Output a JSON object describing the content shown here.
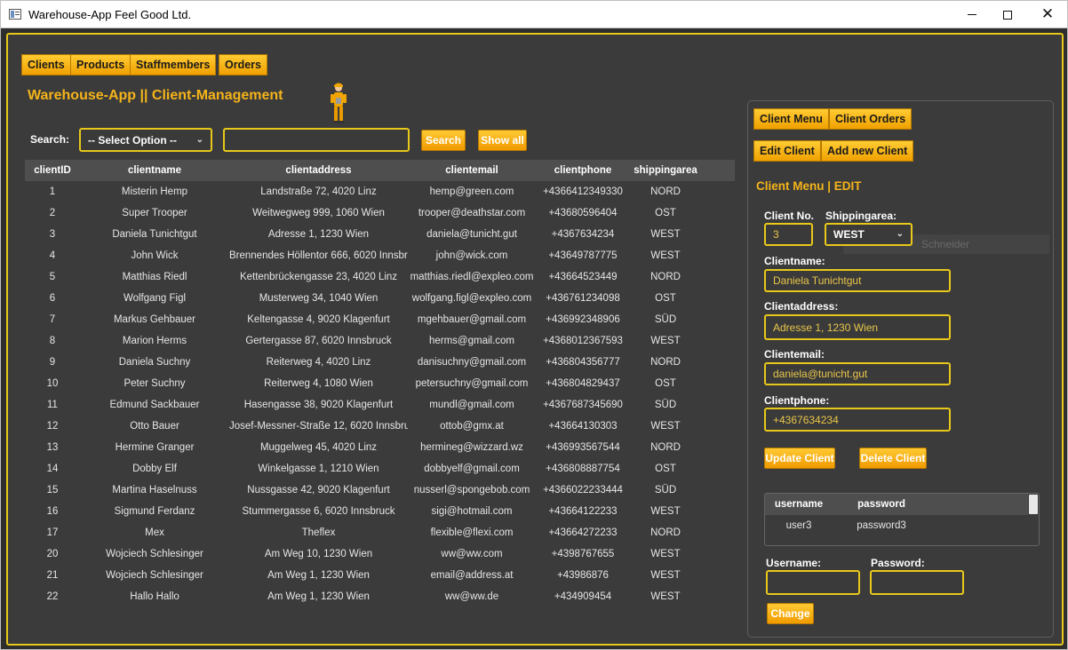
{
  "window": {
    "title": "Warehouse-App Feel Good Ltd."
  },
  "nav_tabs": [
    "Clients",
    "Products",
    "Staffmembers",
    "Orders"
  ],
  "page_title": "Warehouse-App || Client-Management",
  "search": {
    "label": "Search:",
    "select_value": "-- Select Option --",
    "input_value": "",
    "search_button": "Search",
    "show_all_button": "Show all"
  },
  "table": {
    "columns": [
      "clientID",
      "clientname",
      "clientaddress",
      "clientemail",
      "clientphone",
      "shippingarea"
    ],
    "rows": [
      [
        "1",
        "Misterin Hemp",
        "Landstraße 72, 4020 Linz",
        "hemp@green.com",
        "+4366412349330",
        "NORD"
      ],
      [
        "2",
        "Super Trooper",
        "Weitwegweg 999, 1060 Wien",
        "trooper@deathstar.com",
        "+43680596404",
        "OST"
      ],
      [
        "3",
        "Daniela Tunichtgut",
        "Adresse 1, 1230 Wien",
        "daniela@tunicht.gut",
        "+4367634234",
        "WEST"
      ],
      [
        "4",
        "John Wick",
        "Brennendes Höllentor 666, 6020 Innsbruck",
        "john@wick.com",
        "+43649787775",
        "WEST"
      ],
      [
        "5",
        "Matthias Riedl",
        "Kettenbrückengasse 23, 4020 Linz",
        "matthias.riedl@expleo.com",
        "+43664523449",
        "NORD"
      ],
      [
        "6",
        "Wolfgang Figl",
        "Musterweg 34, 1040 Wien",
        "wolfgang.figl@expleo.com",
        "+436761234098",
        "OST"
      ],
      [
        "7",
        "Markus Gehbauer",
        "Keltengasse 4, 9020 Klagenfurt",
        "mgehbauer@gmail.com",
        "+436992348906",
        "SÜD"
      ],
      [
        "8",
        "Marion Herms",
        "Gertergasse 87, 6020 Innsbruck",
        "herms@gmail.com",
        "+4368012367593",
        "WEST"
      ],
      [
        "9",
        "Daniela Suchny",
        "Reiterweg 4, 4020 Linz",
        "danisuchny@gmail.com",
        "+436804356777",
        "NORD"
      ],
      [
        "10",
        "Peter Suchny",
        "Reiterweg 4, 1080 Wien",
        "petersuchny@gmail.com",
        "+436804829437",
        "OST"
      ],
      [
        "11",
        "Edmund Sackbauer",
        "Hasengasse 38, 9020 Klagenfurt",
        "mundl@gmail.com",
        "+4367687345690",
        "SÜD"
      ],
      [
        "12",
        "Otto Bauer",
        "Josef-Messner-Straße 12, 6020 Innsbruck",
        "ottob@gmx.at",
        "+43664130303",
        "WEST"
      ],
      [
        "13",
        "Hermine Granger",
        "Muggelweg 45, 4020 Linz",
        "hermineg@wizzard.wz",
        "+436993567544",
        "NORD"
      ],
      [
        "14",
        "Dobby Elf",
        "Winkelgasse 1, 1210 Wien",
        "dobbyelf@gmail.com",
        "+436808887754",
        "OST"
      ],
      [
        "15",
        "Martina Haselnuss",
        "Nussgasse 42, 9020 Klagenfurt",
        "nusserl@spongebob.com",
        "+4366022233444",
        "SÜD"
      ],
      [
        "16",
        "Sigmund Ferdanz",
        "Stummergasse 6, 6020 Innsbruck",
        "sigi@hotmail.com",
        "+43664122233",
        "WEST"
      ],
      [
        "17",
        "Mex",
        "Theflex",
        "flexible@flexi.com",
        "+43664272233",
        "NORD"
      ],
      [
        "20",
        "Wojciech Schlesinger",
        "Am Weg 10, 1230 Wien",
        "ww@ww.com",
        "+4398767655",
        "WEST"
      ],
      [
        "21",
        "Wojciech Schlesinger",
        "Am Weg 1, 1230 Wien",
        "email@address.at",
        "+43986876",
        "WEST"
      ],
      [
        "22",
        "Hallo Hallo",
        "Am Weg 1, 1230 Wien",
        "ww@ww.de",
        "+434909454",
        "WEST"
      ]
    ]
  },
  "panel": {
    "tabs": [
      "Client Menu",
      "Client Orders"
    ],
    "subtabs": [
      "Edit Client",
      "Add new Client"
    ],
    "heading": "Client Menu | EDIT",
    "ghost_text": "Schneider",
    "fields": {
      "client_no_label": "Client No.",
      "client_no": "3",
      "shipping_label": "Shippingarea:",
      "shipping_value": "WEST",
      "name_label": "Clientname:",
      "name": "Daniela Tunichtgut",
      "address_label": "Clientaddress:",
      "address": "Adresse 1, 1230 Wien",
      "email_label": "Clientemail:",
      "email": "daniela@tunicht.gut",
      "phone_label": "Clientphone:",
      "phone": "+4367634234"
    },
    "update_button": "Update Client",
    "delete_button": "Delete Client",
    "user_table": {
      "columns": [
        "username",
        "password"
      ],
      "rows": [
        [
          "user3",
          "password3"
        ]
      ]
    },
    "username_label": "Username:",
    "password_label": "Password:",
    "username_value": "",
    "password_value": "",
    "change_button": "Change"
  },
  "colors": {
    "accent": "#f5b41a",
    "border": "#e8c81a",
    "background": "#3b3b3b"
  },
  "icons": [
    "app-icon",
    "mascot-icon",
    "chevron-down-icon",
    "minimize-icon",
    "maximize-icon",
    "close-icon"
  ]
}
